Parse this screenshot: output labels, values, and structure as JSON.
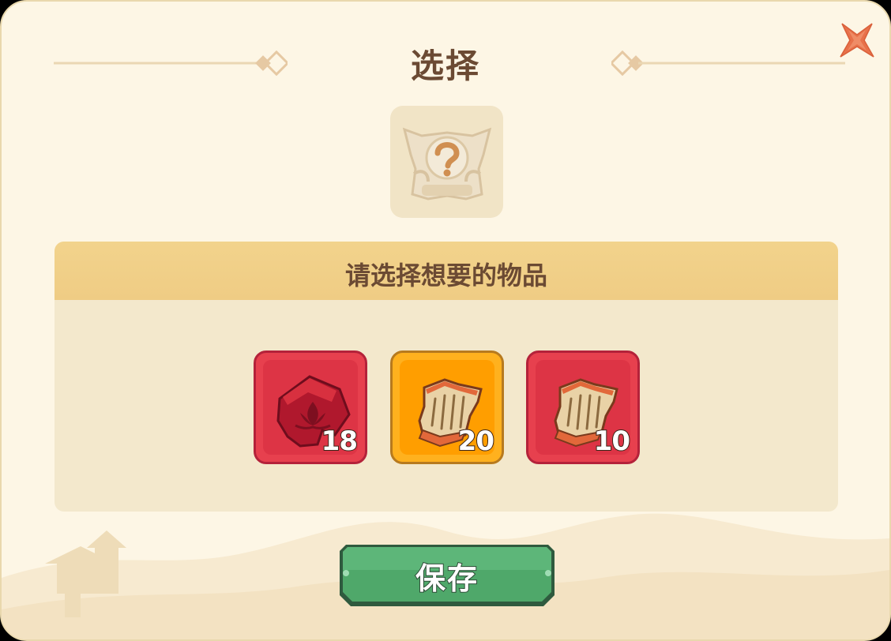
{
  "dialog": {
    "title": "选择",
    "close_icon": "close-x-icon",
    "chest_icon": "mystery-chest-icon",
    "prompt": "请选择想要的物品",
    "items": [
      {
        "icon": "red-jade-puzzle-icon",
        "quantity": "18",
        "frame": "red",
        "selected": false
      },
      {
        "icon": "ancient-scroll-icon",
        "quantity": "20",
        "frame": "orange",
        "selected": true
      },
      {
        "icon": "ancient-scroll-icon",
        "quantity": "10",
        "frame": "red",
        "selected": false
      }
    ],
    "save_label": "保存"
  },
  "colors": {
    "background": "#fdf6e5",
    "title_text": "#6b4a33",
    "header_bar": "#f2d38c",
    "panel": "#f3e8cc",
    "red_frame": "#e7404e",
    "orange_frame": "#ffb11e",
    "close_icon": "#e8714a",
    "save_button": "#4fa86a"
  }
}
